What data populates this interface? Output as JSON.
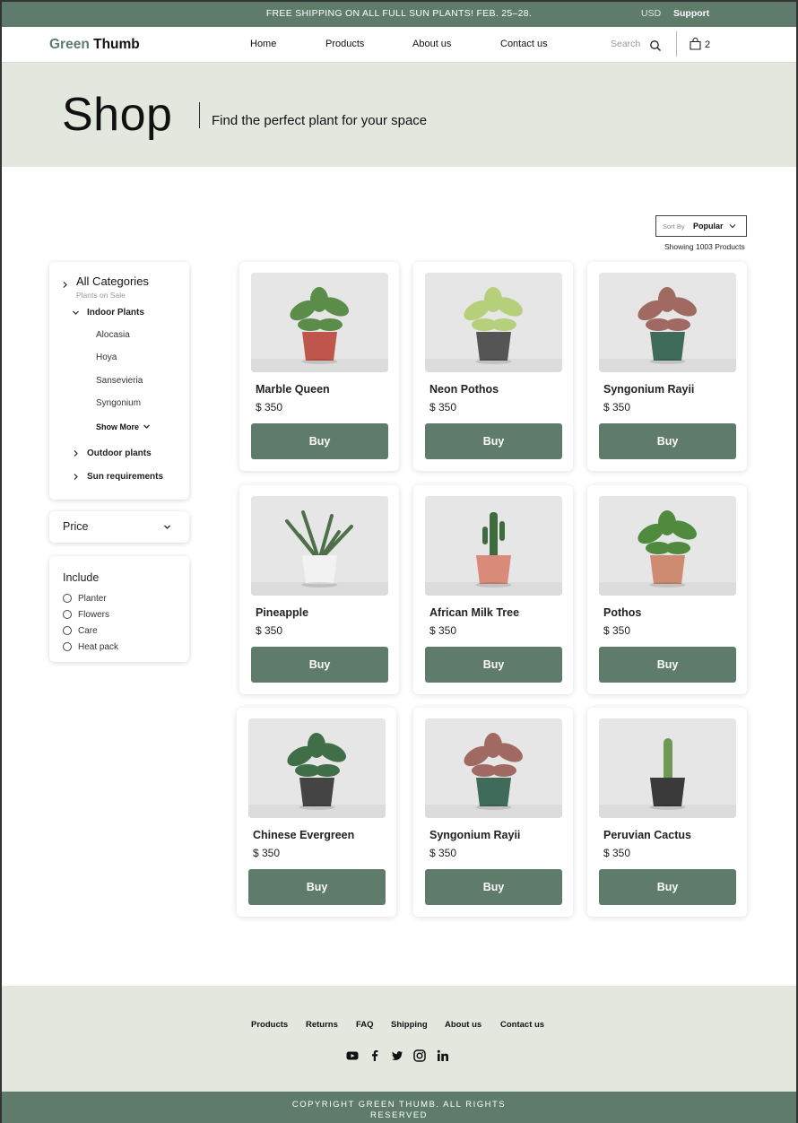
{
  "promo": {
    "message": "FREE SHIPPING ON ALL FULL SUN PLANTS! FEB. 25–28.",
    "currency": "USD",
    "support": "Support"
  },
  "header": {
    "logo_a": "Green",
    "logo_b": " Thumb",
    "nav": [
      "Home",
      "Products",
      "About us",
      "Contact us"
    ],
    "search_placeholder": "Search",
    "cart_count": "2"
  },
  "hero": {
    "title": "Shop",
    "subtitle": "Find the perfect plant for your space"
  },
  "sort": {
    "label": "Sort By",
    "value": "Popular"
  },
  "showing": "Showing 1003 Products",
  "sidebar": {
    "categories_title": "All Categories",
    "categories_sub": "Plants on Sale",
    "indoor": "Indoor Plants",
    "indoor_items": [
      "Alocasia",
      "Hoya",
      "Sansevieria",
      "Syngonium"
    ],
    "show_more": "Show More",
    "outdoor": "Outdoor plants",
    "sun": "Sun requirements",
    "price": "Price",
    "include_title": "Include",
    "include_options": [
      "Planter",
      "Flowers",
      "Care",
      "Heat pack"
    ]
  },
  "products": [
    {
      "name": "Marble Queen",
      "price": "$ 350",
      "buy": "Buy",
      "pot": "#c0564b",
      "leaf": "#5c8c4a"
    },
    {
      "name": "Neon Pothos",
      "price": "$ 350",
      "buy": "Buy",
      "pot": "#555555",
      "leaf": "#b5cf7a"
    },
    {
      "name": "Syngonium Rayii",
      "price": "$ 350",
      "buy": "Buy",
      "pot": "#3f6b5a",
      "leaf": "#a06a62"
    },
    {
      "name": "Pineapple",
      "price": "$ 350",
      "buy": "Buy",
      "pot": "#f2f2f2",
      "leaf": "#4f6e4a"
    },
    {
      "name": "African Milk Tree",
      "price": "$ 350",
      "buy": "Buy",
      "pot": "#d98a78",
      "leaf": "#3e6b3e"
    },
    {
      "name": "Pothos",
      "price": "$ 350",
      "buy": "Buy",
      "pot": "#cf8a72",
      "leaf": "#4f8a3e"
    },
    {
      "name": "Chinese Evergreen",
      "price": "$ 350",
      "buy": "Buy",
      "pot": "#444444",
      "leaf": "#3f6e47"
    },
    {
      "name": "Syngonium Rayii",
      "price": "$ 350",
      "buy": "Buy",
      "pot": "#3f6b5a",
      "leaf": "#a06a62"
    },
    {
      "name": "Peruvian Cactus",
      "price": "$ 350",
      "buy": "Buy",
      "pot": "#3a3a3a",
      "leaf": "#6f9a55"
    }
  ],
  "footer": {
    "links": [
      "Products",
      "Returns",
      "FAQ",
      "Shipping",
      "About us",
      "Contact us"
    ],
    "social": [
      "youtube-icon",
      "facebook-icon",
      "twitter-icon",
      "instagram-icon",
      "linkedin-icon"
    ],
    "copyright": "COPYRIGHT GREEN THUMB. ALL RIGHTS RESERVED"
  },
  "colors": {
    "accent": "#5e7b6b",
    "hero_bg": "#e3e8df"
  }
}
